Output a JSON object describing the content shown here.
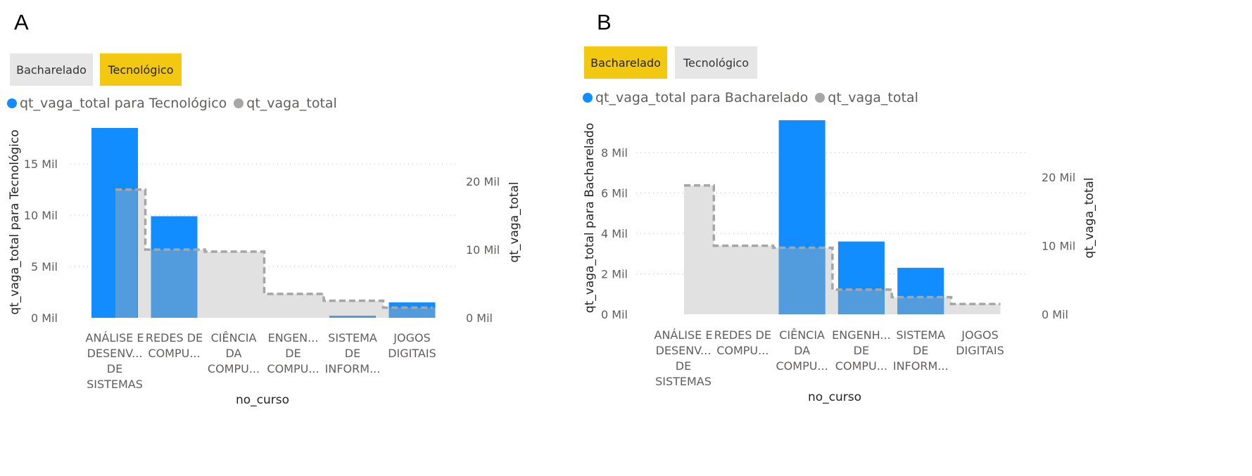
{
  "colors": {
    "selected_bar": "#118dff",
    "selected_bar_overlap": "#529bdd",
    "total_area": "#e1e1e1",
    "total_line": "#a6a6a6",
    "slicer_active": "#f2c811",
    "slicer_inactive": "#e6e6e6",
    "gridline": "#c8c8c8",
    "axis_text": "#605e5c"
  },
  "panels": [
    {
      "letter": "A",
      "slicer": {
        "options": [
          "Bacharelado",
          "Tecnológico"
        ],
        "active": "Tecnológico"
      },
      "legend": [
        {
          "label": "qt_vaga_total para Tecnológico",
          "color": "#118dff"
        },
        {
          "label": "qt_vaga_total",
          "color": "#a6a6a6"
        }
      ]
    },
    {
      "letter": "B",
      "slicer": {
        "options": [
          "Bacharelado",
          "Tecnológico"
        ],
        "active": "Bacharelado"
      },
      "legend": [
        {
          "label": "qt_vaga_total para Bacharelado",
          "color": "#118dff"
        },
        {
          "label": "qt_vaga_total",
          "color": "#a6a6a6"
        }
      ]
    }
  ],
  "chart_data": [
    {
      "type": "bar",
      "subtype": "combo bar + stepped area (dual axis)",
      "xlabel": "no_curso",
      "ylabel": "qt_vaga_total para Tecnológico",
      "y2label": "qt_vaga_total",
      "categories": [
        [
          "ANÁLISE E",
          "DESENV...",
          "DE",
          "SISTEMAS"
        ],
        [
          "REDES DE",
          "COMPU..."
        ],
        [
          "CIÊNCIA",
          "DA",
          "COMPU..."
        ],
        [
          "ENGEN...",
          "DE",
          "COMPU..."
        ],
        [
          "SISTEMA",
          "DE",
          "INFORM..."
        ],
        [
          "JOGOS",
          "DIGITAIS"
        ]
      ],
      "series": [
        {
          "name": "qt_vaga_total para Tecnológico",
          "axis": "left",
          "values": [
            18500,
            9900,
            0,
            0,
            200,
            1500
          ]
        },
        {
          "name": "qt_vaga_total",
          "axis": "right",
          "values": [
            18800,
            10000,
            9700,
            3500,
            2500,
            1500
          ]
        }
      ],
      "ylim": [
        0,
        18500
      ],
      "yticks": [
        {
          "value": 0,
          "label": "0 Mil"
        },
        {
          "value": 5000,
          "label": "5 Mil"
        },
        {
          "value": 10000,
          "label": "10 Mil"
        },
        {
          "value": 15000,
          "label": "15 Mil"
        }
      ],
      "y2lim": [
        0,
        27000
      ],
      "y2ticks": [
        {
          "value": 0,
          "label": "0 Mil"
        },
        {
          "value": 10000,
          "label": "10 Mil"
        },
        {
          "value": 20000,
          "label": "20 Mil"
        }
      ],
      "grid": true
    },
    {
      "type": "bar",
      "subtype": "combo bar + stepped area (dual axis)",
      "xlabel": "no_curso",
      "ylabel": "qt_vaga_total para Bacharelado",
      "y2label": "qt_vaga_total",
      "categories": [
        [
          "ANÁLISE E",
          "DESENV...",
          "DE",
          "SISTEMAS"
        ],
        [
          "REDES DE",
          "COMPU..."
        ],
        [
          "CIÊNCIA",
          "DA",
          "COMPU..."
        ],
        [
          "ENGENH...",
          "DE",
          "COMPU..."
        ],
        [
          "SISTEMA",
          "DE",
          "INFORM..."
        ],
        [
          "JOGOS",
          "DIGITAIS"
        ]
      ],
      "series": [
        {
          "name": "qt_vaga_total para Bacharelado",
          "axis": "left",
          "values": [
            0,
            0,
            9600,
            3600,
            2300,
            0
          ]
        },
        {
          "name": "qt_vaga_total",
          "axis": "right",
          "values": [
            18800,
            10000,
            9700,
            3600,
            2500,
            1500
          ]
        }
      ],
      "ylim": [
        0,
        9600
      ],
      "yticks": [
        {
          "value": 0,
          "label": "0 Mil"
        },
        {
          "value": 2000,
          "label": "2 Mil"
        },
        {
          "value": 4000,
          "label": "4 Mil"
        },
        {
          "value": 6000,
          "label": "6 Mil"
        },
        {
          "value": 8000,
          "label": "8 Mil"
        }
      ],
      "y2lim": [
        0,
        29000
      ],
      "y2ticks": [
        {
          "value": 0,
          "label": "0 Mil"
        },
        {
          "value": 10000,
          "label": "10 Mil"
        },
        {
          "value": 20000,
          "label": "20 Mil"
        }
      ],
      "grid": true
    }
  ]
}
